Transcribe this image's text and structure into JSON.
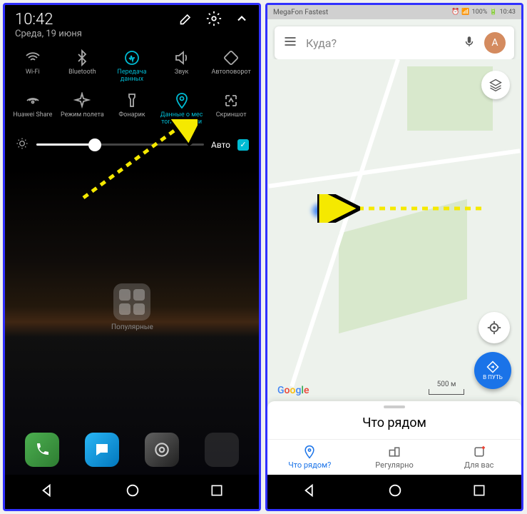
{
  "left": {
    "status": {
      "time": "10:42",
      "date": "Среда, 19 июня"
    },
    "tiles_row1": [
      {
        "label": "Wi-Fi",
        "active": false
      },
      {
        "label": "Bluetooth",
        "active": false
      },
      {
        "label": "Передача данных",
        "active": true
      },
      {
        "label": "Звук",
        "active": false
      },
      {
        "label": "Автоповорот",
        "active": false
      }
    ],
    "tiles_row2": [
      {
        "label": "Huawei Share",
        "active": false
      },
      {
        "label": "Режим полета",
        "active": false
      },
      {
        "label": "Фонарик",
        "active": false
      },
      {
        "label": "Данные о мес тоположении",
        "active": true
      },
      {
        "label": "Скриншот",
        "active": false
      }
    ],
    "brightness": {
      "auto_label": "Авто",
      "auto_on": true,
      "percent": 35
    },
    "folder_label": "Популярные"
  },
  "right": {
    "status": {
      "carrier": "MegaFon Fastest",
      "battery": "100%",
      "time": "10:43"
    },
    "search_placeholder": "Куда?",
    "avatar_letter": "A",
    "go_label": "В ПУТЬ",
    "scale_label": "500 м",
    "google_logo": "Google",
    "sheet_title": "Что рядом",
    "tabs": [
      {
        "label": "Что рядом?",
        "active": true
      },
      {
        "label": "Регулярно",
        "active": false
      },
      {
        "label": "Для вас",
        "active": false
      }
    ]
  }
}
